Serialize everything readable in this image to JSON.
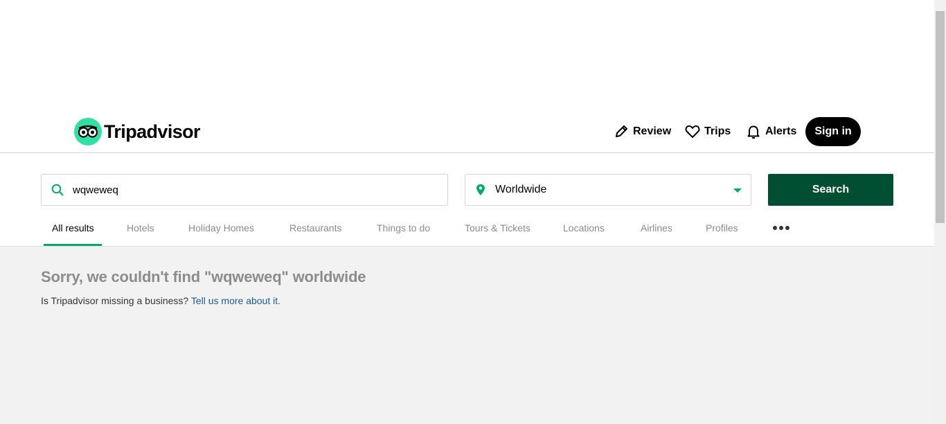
{
  "header": {
    "logo_text": "Tripadvisor",
    "nav": {
      "review": "Review",
      "trips": "Trips",
      "alerts": "Alerts"
    },
    "signin": "Sign in"
  },
  "search": {
    "query": "wqweweq",
    "location": "Worldwide",
    "button": "Search"
  },
  "tabs": [
    {
      "label": "All results",
      "active": true
    },
    {
      "label": "Hotels"
    },
    {
      "label": "Holiday Homes"
    },
    {
      "label": "Restaurants"
    },
    {
      "label": "Things to do"
    },
    {
      "label": "Tours & Tickets"
    },
    {
      "label": "Locations"
    },
    {
      "label": "Airlines"
    },
    {
      "label": "Profiles"
    }
  ],
  "results": {
    "message": "Sorry, we couldn't find \"wqweweq\" worldwide",
    "missing_prefix": "Is Tripadvisor missing a business?",
    "missing_link": "Tell us more about it."
  },
  "colors": {
    "brand_green": "#34e0a1",
    "search_button": "#004f32",
    "active_tab_underline": "#00aa6c",
    "link": "#1a5e8c"
  },
  "icons": {
    "logo": "owl-eyes-icon",
    "review": "pencil-icon",
    "trips": "heart-icon",
    "alerts": "bell-icon",
    "query": "search-icon",
    "location": "map-pin-icon",
    "location_dropdown": "caret-down-icon",
    "more_tabs": "more-dots-icon"
  }
}
